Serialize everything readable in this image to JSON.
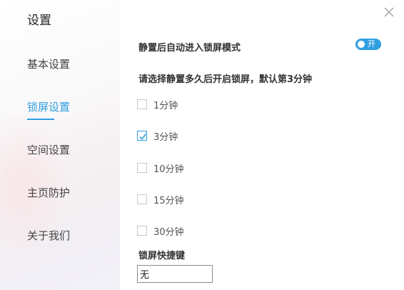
{
  "sidebar": {
    "title": "设置",
    "items": [
      {
        "label": "基本设置",
        "active": false
      },
      {
        "label": "锁屏设置",
        "active": true
      },
      {
        "label": "空间设置",
        "active": false
      },
      {
        "label": "主页防护",
        "active": false
      },
      {
        "label": "关于我们",
        "active": false
      }
    ]
  },
  "window": {
    "close_icon": "close-icon"
  },
  "lock_screen": {
    "auto_lock_label": "静置后自动进入锁屏模式",
    "auto_lock_toggle": {
      "state": "on",
      "label": "开"
    },
    "duration_prompt": "请选择静置多久后开启锁屏，默认第3分钟",
    "options": [
      {
        "label": "1分钟",
        "checked": false
      },
      {
        "label": "3分钟",
        "checked": true
      },
      {
        "label": "10分钟",
        "checked": false
      },
      {
        "label": "15分钟",
        "checked": false
      },
      {
        "label": "30分钟",
        "checked": false
      }
    ],
    "hotkey_label": "锁屏快捷键",
    "hotkey_value": "无"
  },
  "colors": {
    "accent": "#2f9fe0",
    "text": "#333333",
    "checkbox_border": "#c8c8c8"
  }
}
